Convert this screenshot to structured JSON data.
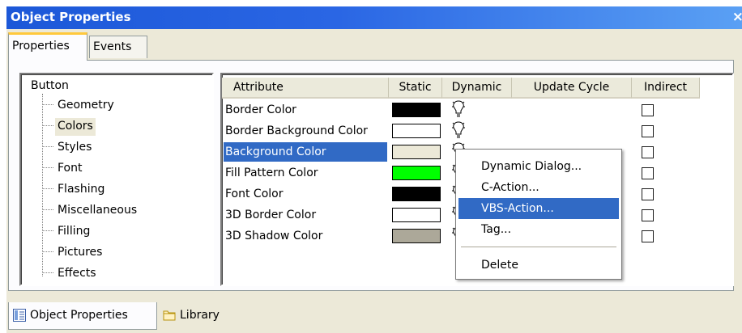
{
  "window": {
    "title": "Object Properties",
    "close": "×"
  },
  "tabs": [
    {
      "label": "Properties"
    },
    {
      "label": "Events"
    }
  ],
  "tree": {
    "root": "Button",
    "items": [
      "Geometry",
      "Colors",
      "Styles",
      "Font",
      "Flashing",
      "Miscellaneous",
      "Filling",
      "Pictures",
      "Effects"
    ],
    "selected": "Colors"
  },
  "grid": {
    "headers": [
      "Attribute",
      "Static",
      "Dynamic",
      "Update Cycle",
      "Indirect"
    ],
    "rows": [
      {
        "attribute": "Border Color",
        "color": "#000000",
        "indirect": false
      },
      {
        "attribute": "Border Background Color",
        "color": "#ffffff",
        "indirect": false
      },
      {
        "attribute": "Background Color",
        "color": "#ece9d8",
        "indirect": false,
        "selected": true
      },
      {
        "attribute": "Fill Pattern Color",
        "color": "#00ff00",
        "indirect": false
      },
      {
        "attribute": "Font Color",
        "color": "#000000",
        "indirect": false
      },
      {
        "attribute": "3D Border Color",
        "color": "#ffffff",
        "indirect": false
      },
      {
        "attribute": "3D Shadow Color",
        "color": "#aca899",
        "indirect": false
      }
    ]
  },
  "context_menu": {
    "items": [
      "Dynamic Dialog...",
      "C-Action...",
      "VBS-Action...",
      "Tag...",
      "Delete"
    ],
    "highlighted": "VBS-Action..."
  },
  "bottom_tabs": [
    {
      "label": "Object Properties",
      "icon": "properties-icon"
    },
    {
      "label": "Library",
      "icon": "library-folder-icon"
    }
  ],
  "colors": {
    "title_bar": "#1c58d8",
    "selection": "#316ac5",
    "tab_accent": "#ffc83c"
  }
}
